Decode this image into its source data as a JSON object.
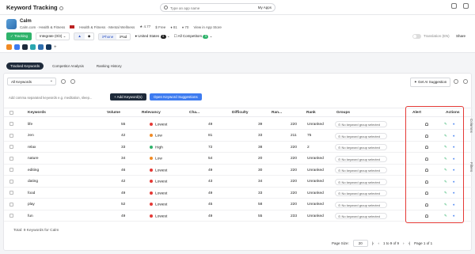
{
  "header": {
    "title": "Keyword Tracking",
    "search_placeholder": "Type an app name",
    "my_apps": "My Apps"
  },
  "app": {
    "name": "Calm",
    "meta": "Calm.com · Health & Fitness",
    "category": "Health & Fitness · Mental Wellness",
    "rating": "4.77",
    "price": "Free",
    "count1": "81",
    "count2": "70",
    "store_link": "View in App Store",
    "tracking": "Tracking",
    "integrate": "Integrate (0/3)",
    "device_iphone": "iPhone",
    "device_ipad": "iPad",
    "country": "United States",
    "country_badge": "9",
    "competitors": "All Competitors",
    "competitors_badge": "9",
    "translation": "Translation (EN)",
    "share": "Share"
  },
  "tabs": [
    {
      "label": "Tracked Keywords"
    },
    {
      "label": "Competitor Analysis"
    },
    {
      "label": "Ranking History"
    }
  ],
  "toolbar": {
    "filter": "All Keywords",
    "ai": "Get AI Suggestion",
    "kw_placeholder": "Add comma separated keywords e.g. meditation, sleep...",
    "add_btn": "+ Add Keyword(s)",
    "open_btn": "Open Keyword Suggestions"
  },
  "columns": {
    "keywords": "Keywords",
    "volume": "Volume",
    "relevancy": "Relevancy",
    "chance": "Cha...",
    "difficulty": "Difficulty",
    "ranked": "Ran...",
    "rank": "Rank",
    "groups": "Groups",
    "alert": "Alert",
    "actions": "Actions"
  },
  "rows": [
    {
      "keyword": "life",
      "volume": "55",
      "relevancy": "Lowest",
      "chance": "49",
      "difficulty": "39",
      "ranked": "220",
      "rank": "Unranked",
      "group": "No keyword group selected",
      "color": "#e53935"
    },
    {
      "keyword": "zen",
      "volume": "42",
      "relevancy": "Low",
      "chance": "81",
      "difficulty": "33",
      "ranked": "211",
      "rank": "75",
      "group": "No keyword group selected",
      "color": "#f08a24"
    },
    {
      "keyword": "relax",
      "volume": "33",
      "relevancy": "High",
      "chance": "72",
      "difficulty": "38",
      "ranked": "220",
      "rank": "2",
      "group": "No keyword group selected",
      "color": "#2fb36b"
    },
    {
      "keyword": "nature",
      "volume": "34",
      "relevancy": "Low",
      "chance": "54",
      "difficulty": "20",
      "ranked": "220",
      "rank": "Unranked",
      "group": "No keyword group selected",
      "color": "#f08a24"
    },
    {
      "keyword": "editing",
      "volume": "46",
      "relevancy": "Lowest",
      "chance": "49",
      "difficulty": "30",
      "ranked": "220",
      "rank": "Unranked",
      "group": "No keyword group selected",
      "color": "#e53935"
    },
    {
      "keyword": "dating",
      "volume": "42",
      "relevancy": "Lowest",
      "chance": "43",
      "difficulty": "34",
      "ranked": "220",
      "rank": "Unranked",
      "group": "No keyword group selected",
      "color": "#e53935"
    },
    {
      "keyword": "food",
      "volume": "49",
      "relevancy": "Lowest",
      "chance": "49",
      "difficulty": "33",
      "ranked": "220",
      "rank": "Unranked",
      "group": "No keyword group selected",
      "color": "#e53935"
    },
    {
      "keyword": "play",
      "volume": "52",
      "relevancy": "Lowest",
      "chance": "45",
      "difficulty": "58",
      "ranked": "220",
      "rank": "Unranked",
      "group": "No keyword group selected",
      "color": "#e53935"
    },
    {
      "keyword": "fun",
      "volume": "49",
      "relevancy": "Lowest",
      "chance": "49",
      "difficulty": "55",
      "ranked": "233",
      "rank": "Unranked",
      "group": "No keyword group selected",
      "color": "#e53935"
    }
  ],
  "footer": {
    "total": "Total: 9 Keywords for Calm",
    "page_size_label": "Page Size:",
    "page_size": "20",
    "range": "1 to 9 of 9",
    "page": "Page 1 of 1"
  },
  "side": {
    "columns": "Columns",
    "filters": "Filters"
  }
}
